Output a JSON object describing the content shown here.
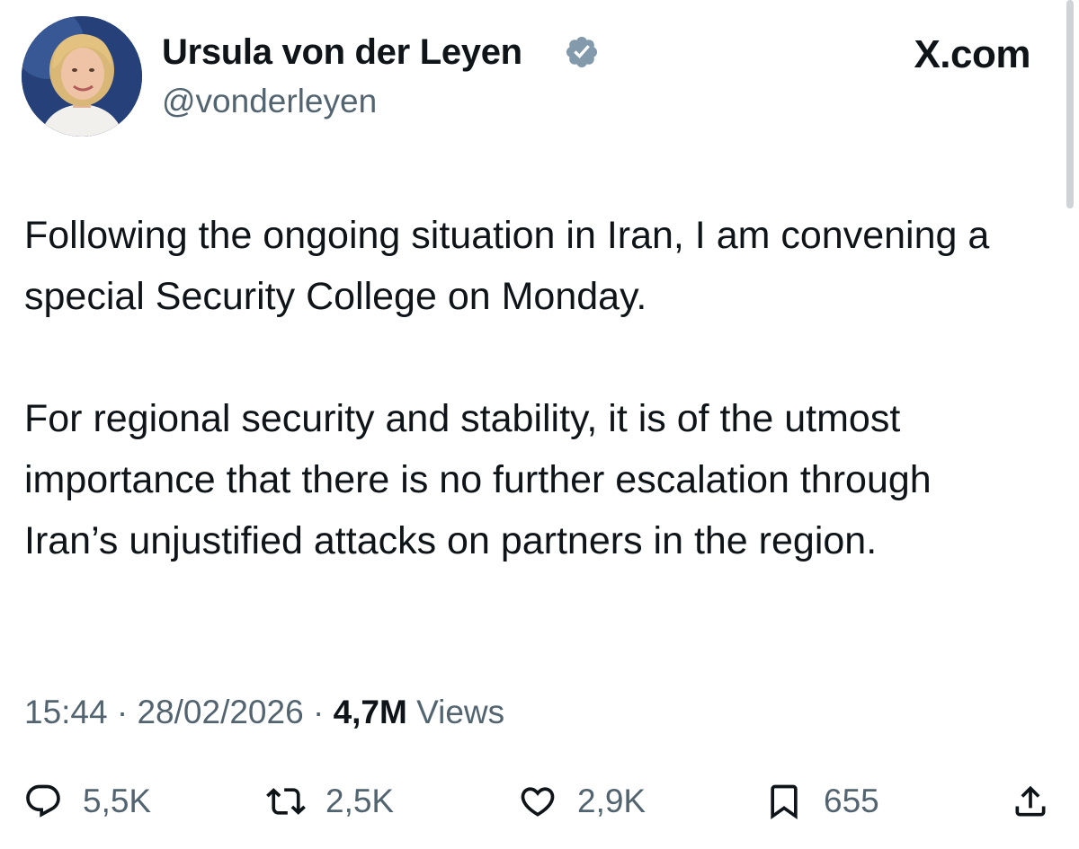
{
  "author": {
    "display_name": "Ursula von der Leyen",
    "handle": "@vonderleyen",
    "verified_color": "#829aab"
  },
  "brand": "X.com",
  "tweet": {
    "paragraphs": [
      "Following the ongoing situation in Iran, I am convening a special Security College on Monday.",
      "For regional security and stability, it is of the utmost importance that there is no further escalation through Iran’s unjustified attacks on partners in the region."
    ]
  },
  "meta": {
    "time": "15:44",
    "separator": "·",
    "date": "28/02/2026",
    "views_count": "4,7M",
    "views_label": "Views"
  },
  "actions": {
    "replies": "5,5K",
    "reposts": "2,5K",
    "likes": "2,9K",
    "bookmarks": "655"
  },
  "icons": {
    "reply": "reply-icon",
    "repost": "repost-icon",
    "like": "heart-icon",
    "bookmark": "bookmark-icon",
    "share": "share-icon",
    "verified": "verified-badge-icon"
  }
}
